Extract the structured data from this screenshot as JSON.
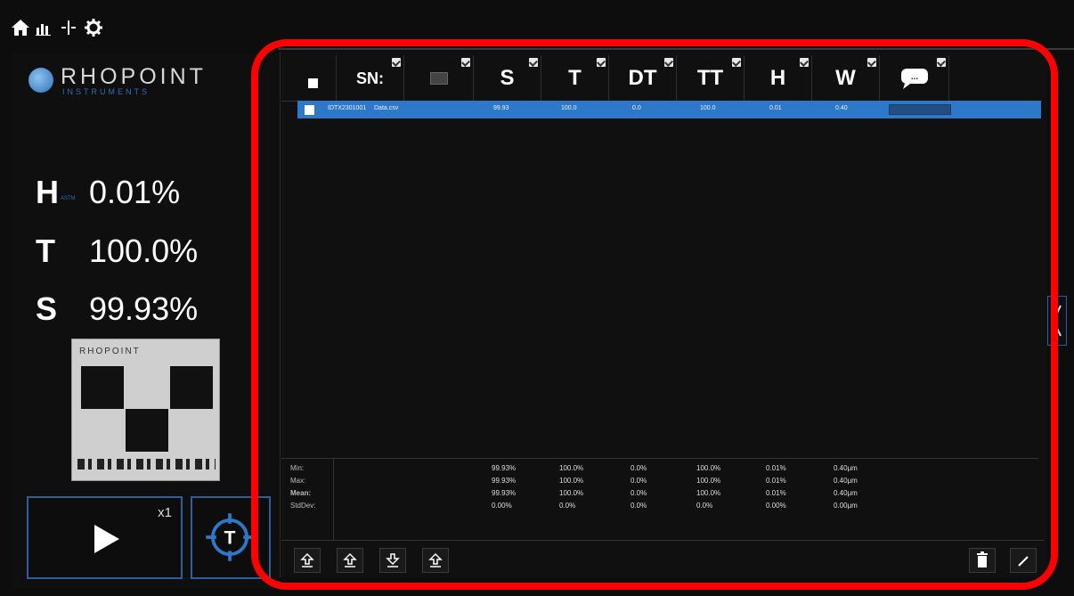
{
  "toolbar": {
    "icons": [
      "home-icon",
      "bar-chart-icon",
      "crosshair-icon",
      "gear-icon"
    ]
  },
  "brand": {
    "name": "RHOPOINT",
    "sub": "INSTRUMENTS"
  },
  "readings": [
    {
      "letter": "H",
      "sub": "ASTM",
      "value": "0.01%"
    },
    {
      "letter": "T",
      "sub": "",
      "value": "100.0%"
    },
    {
      "letter": "S",
      "sub": "",
      "value": "99.93%"
    }
  ],
  "standard_card": {
    "logo": "RHOPOINT"
  },
  "play_button": {
    "multiplier": "x1"
  },
  "target_button": {
    "label": "T"
  },
  "table": {
    "columns": [
      {
        "key": "select",
        "label": ""
      },
      {
        "key": "sn",
        "label": "SN:"
      },
      {
        "key": "file",
        "label": ""
      },
      {
        "key": "s",
        "label": "S"
      },
      {
        "key": "t",
        "label": "T"
      },
      {
        "key": "dt",
        "label": "DT"
      },
      {
        "key": "tt",
        "label": "TT"
      },
      {
        "key": "h",
        "label": "H"
      },
      {
        "key": "w",
        "label": "W"
      },
      {
        "key": "comment",
        "label": "..."
      }
    ],
    "rows": [
      {
        "sn": "IDTX2301001",
        "file": "Data.csv",
        "s": "99.93",
        "t": "100.0",
        "dt": "0.0",
        "tt": "100.0",
        "h": "0.01",
        "w": "0.40"
      }
    ],
    "stats": {
      "labels": [
        "Min:",
        "Max:",
        "Mean:",
        "StdDev:"
      ],
      "s": [
        "99.93%",
        "99.93%",
        "99.93%",
        "0.00%"
      ],
      "t": [
        "100.0%",
        "100.0%",
        "100.0%",
        "0.0%"
      ],
      "dt": [
        "0.0%",
        "0.0%",
        "0.0%",
        "0.0%"
      ],
      "tt": [
        "100.0%",
        "100.0%",
        "100.0%",
        "0.0%"
      ],
      "h": [
        "0.01%",
        "0.01%",
        "0.01%",
        "0.00%"
      ],
      "w": [
        "0.40μm",
        "0.40μm",
        "0.40μm",
        "0.00μm"
      ]
    }
  },
  "colors": {
    "accent": "#2e78c9",
    "highlight": "#ff0000"
  }
}
